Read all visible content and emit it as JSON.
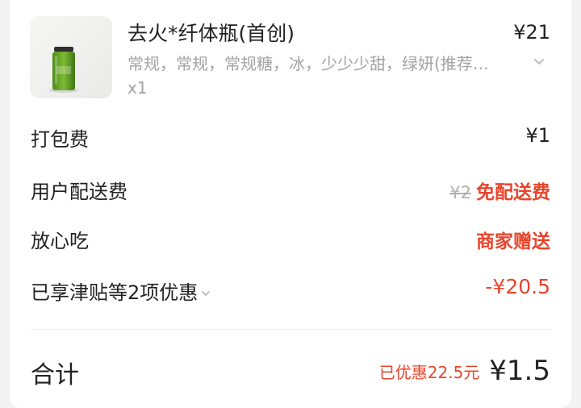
{
  "product": {
    "name": "去火*纤体瓶(首创)",
    "price": "¥21",
    "specs": "常规，常规，常规糖，冰，少少少甜，绿妍(推荐…",
    "quantity": "x1",
    "image_icon": "juice-bottle-icon"
  },
  "fees": {
    "packing_label": "打包费",
    "packing_value": "¥1",
    "delivery_label": "用户配送费",
    "delivery_original": "¥2",
    "delivery_value": "免配送费",
    "assurance_label": "放心吃",
    "assurance_value": "商家赠送",
    "discount_label": "已享津贴等2项优惠",
    "discount_value": "-¥20.5"
  },
  "total": {
    "label": "合计",
    "saved": "已优惠22.5元",
    "amount": "¥1.5"
  },
  "colors": {
    "accent_red": "#e8452c",
    "muted": "#a3a3a3"
  }
}
